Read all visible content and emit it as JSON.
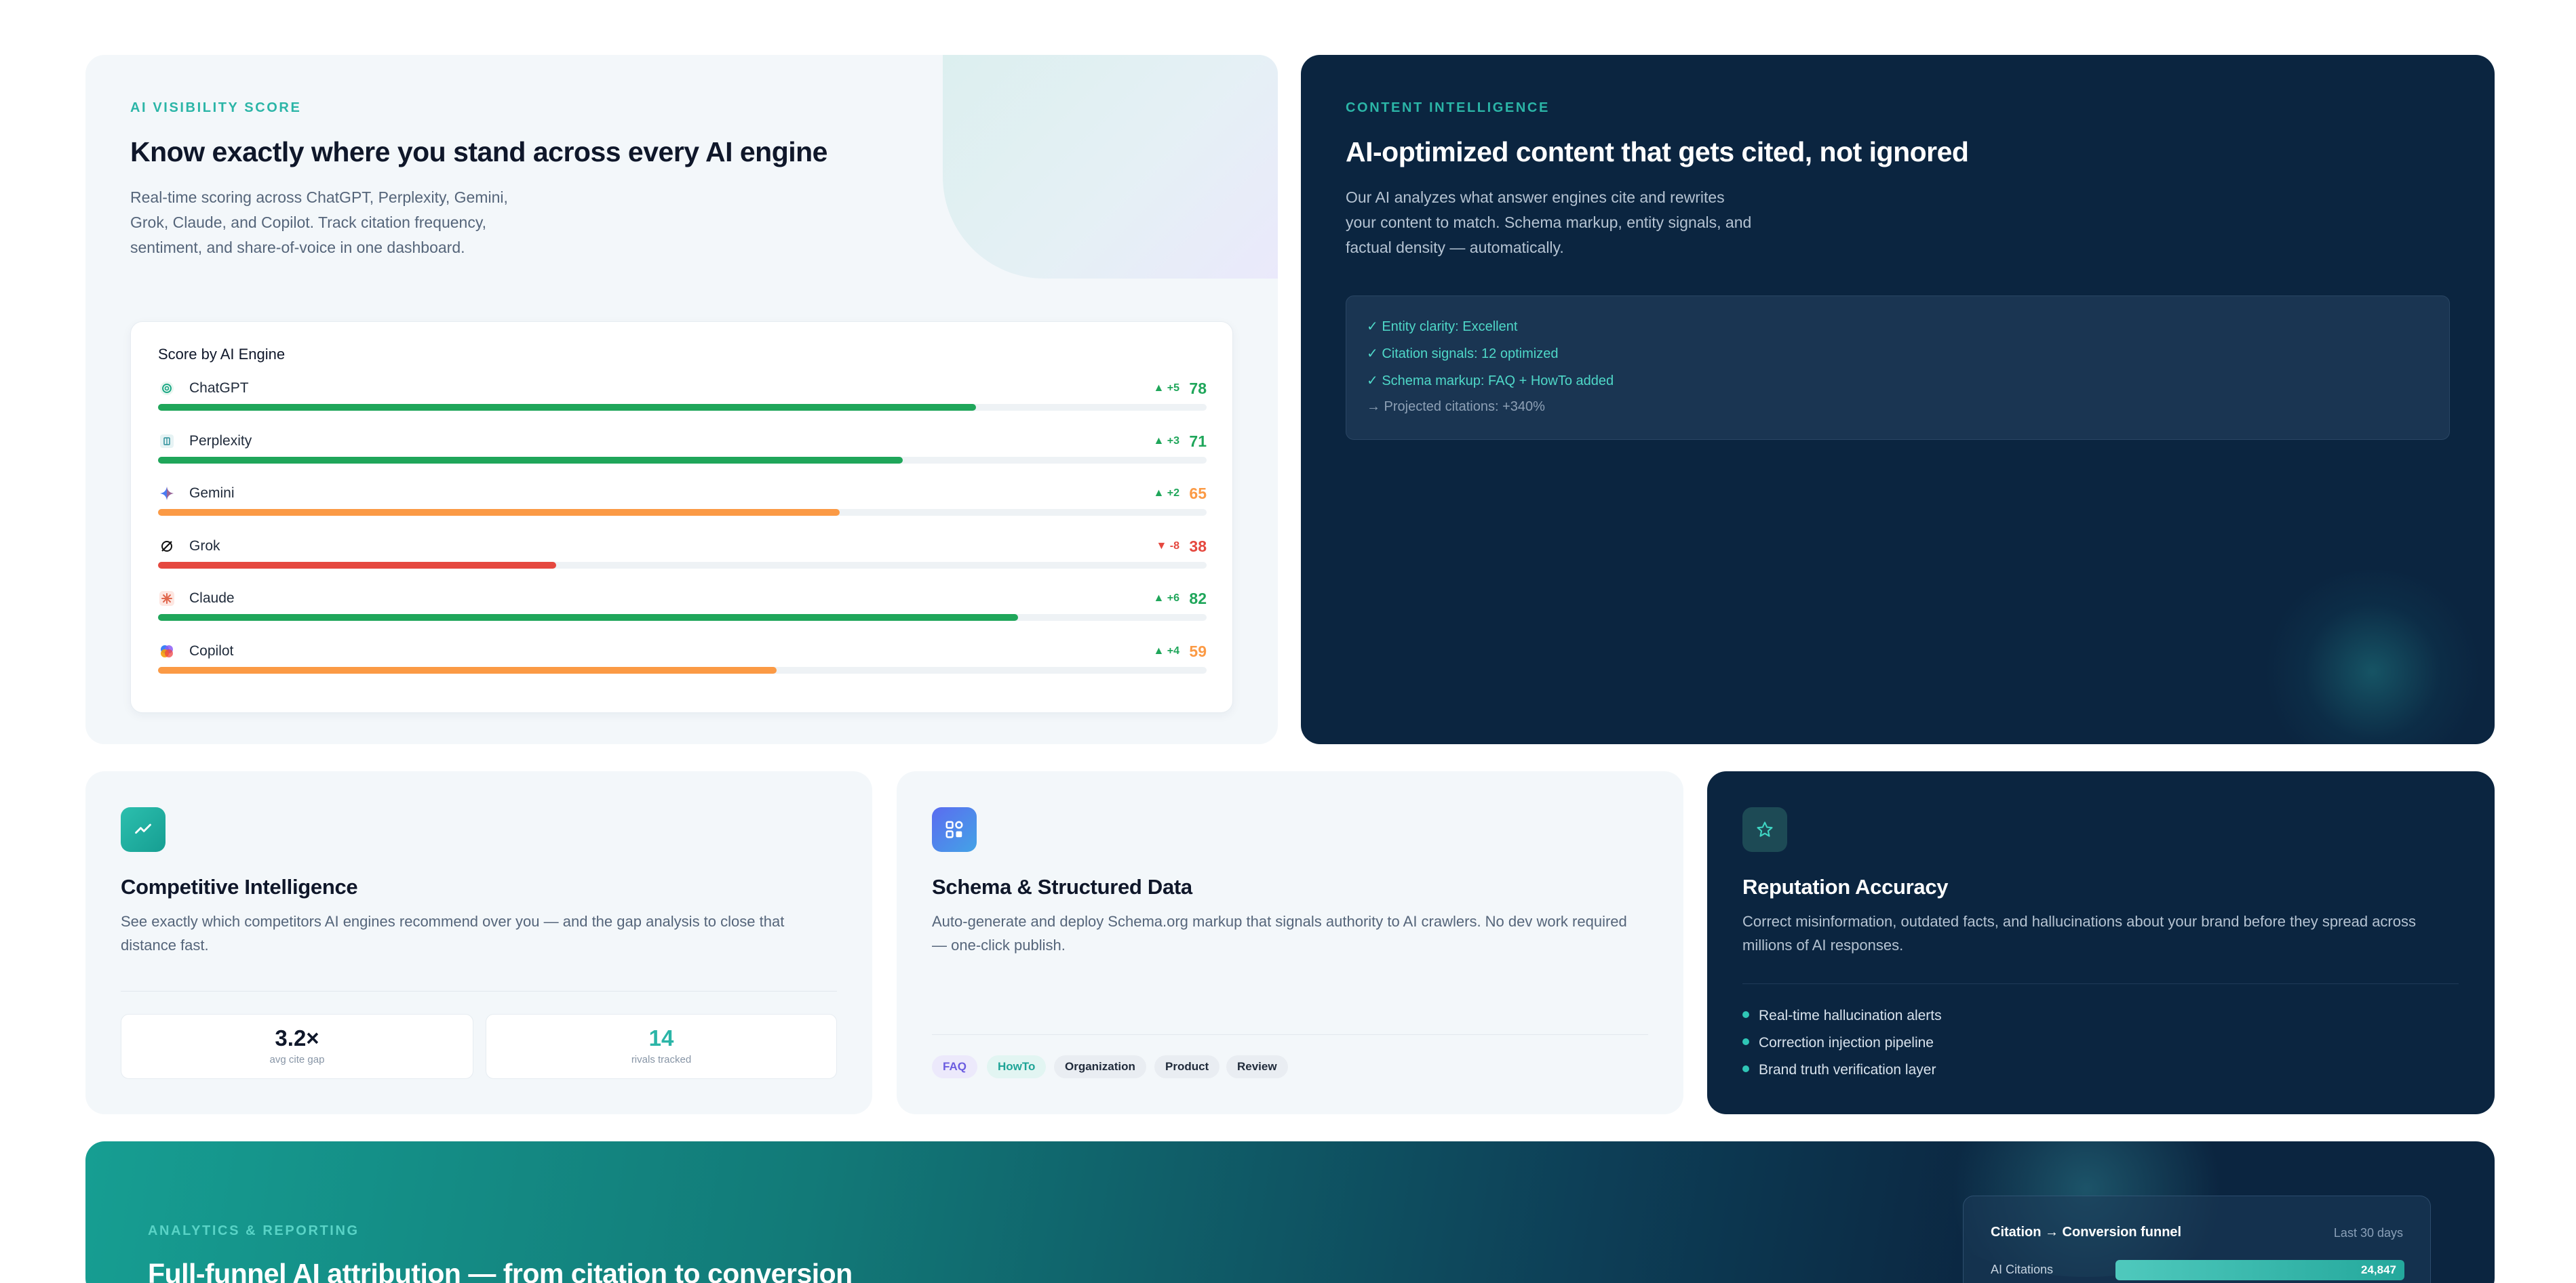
{
  "visibility": {
    "eyebrow": "AI VISIBILITY SCORE",
    "title": "Know exactly where you stand across every AI engine",
    "description": "Real-time scoring across ChatGPT, Perplexity, Gemini, Grok, Claude, and Copilot. Track citation frequency, sentiment, and share-of-voice in one dashboard.",
    "score_title": "Score by AI Engine",
    "engines": [
      {
        "name": "ChatGPT",
        "delta": "▲ +5",
        "score": "78",
        "value": 78,
        "status": "good",
        "icon": "chatgpt-icon"
      },
      {
        "name": "Perplexity",
        "delta": "▲ +3",
        "score": "71",
        "value": 71,
        "status": "good",
        "icon": "perplexity-icon"
      },
      {
        "name": "Gemini",
        "delta": "▲ +2",
        "score": "65",
        "value": 65,
        "status": "warn",
        "icon": "gemini-icon"
      },
      {
        "name": "Grok",
        "delta": "▼ -8",
        "score": "38",
        "value": 38,
        "status": "bad",
        "icon": "grok-icon"
      },
      {
        "name": "Claude",
        "delta": "▲ +6",
        "score": "82",
        "value": 82,
        "status": "good",
        "icon": "claude-icon"
      },
      {
        "name": "Copilot",
        "delta": "▲ +4",
        "score": "59",
        "value": 59,
        "status": "warn",
        "icon": "copilot-icon"
      }
    ]
  },
  "content": {
    "eyebrow": "CONTENT INTELLIGENCE",
    "title": "AI-optimized content that gets cited, not ignored",
    "description": "Our AI analyzes what answer engines cite and rewrites your content to match. Schema markup, entity signals, and factual density — automatically.",
    "lines": [
      "✓ Entity clarity: Excellent",
      "✓ Citation signals: 12 optimized",
      "✓ Schema markup: FAQ + HowTo added",
      "→ Projected citations: +340%"
    ]
  },
  "competitive": {
    "title": "Competitive Intelligence",
    "description": "See exactly which competitors AI engines recommend over you — and the gap analysis to close that distance fast.",
    "stat1_value": "3.2×",
    "stat1_label": "avg cite gap",
    "stat2_value": "14",
    "stat2_label": "rivals tracked",
    "icon": "trend-icon"
  },
  "schema": {
    "title": "Schema & Structured Data",
    "description": "Auto-generate and deploy Schema.org markup that signals authority to AI crawlers. No dev work required — one-click publish.",
    "chips": [
      "FAQ",
      "HowTo",
      "Organization",
      "Product",
      "Review"
    ],
    "icon": "grid-icon"
  },
  "reputation": {
    "title": "Reputation Accuracy",
    "description": "Correct misinformation, outdated facts, and hallucinations about your brand before they spread across millions of AI responses.",
    "bullets": [
      "Real-time hallucination alerts",
      "Correction injection pipeline",
      "Brand truth verification layer"
    ],
    "icon": "star-icon"
  },
  "analytics": {
    "eyebrow": "ANALYTICS & REPORTING",
    "title": "Full-funnel AI attribution — from citation to conversion",
    "funnel_title": "Citation → Conversion funnel",
    "funnel_range": "Last 30 days",
    "funnel_row_label": "AI Citations",
    "funnel_row_value": "24,847"
  },
  "colors": {
    "good": "#1fa65a",
    "warn": "#fb9a45",
    "bad": "#e5483f",
    "accent": "#2bb5a7",
    "navy": "#0b2540"
  }
}
